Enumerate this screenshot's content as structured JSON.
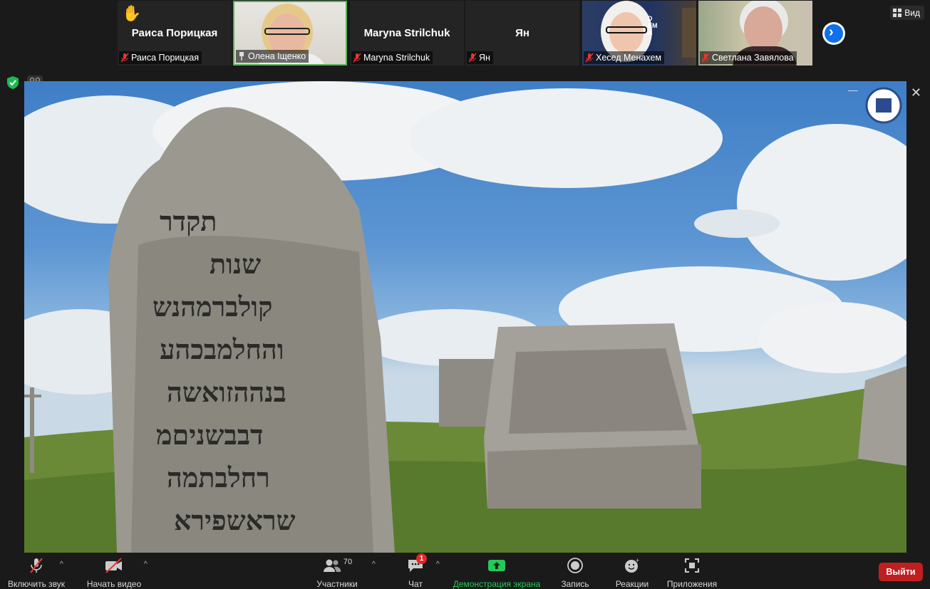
{
  "participants": [
    {
      "name_large": "Раиса Порицкая",
      "label": "Раиса Порицкая",
      "hand_raised": true,
      "video": false
    },
    {
      "name_large": "",
      "label": "Олена Іщенко",
      "hand_raised": false,
      "video": true,
      "active": true
    },
    {
      "name_large": "Maryna Strilchuk",
      "label": "Maryna Strilchuk",
      "hand_raised": false,
      "video": false
    },
    {
      "name_large": "Ян",
      "label": "Ян",
      "hand_raised": false,
      "video": false
    },
    {
      "name_large": "",
      "label": "Хесед Менахем",
      "hand_raised": false,
      "video": true
    },
    {
      "name_large": "",
      "label": "Светлана Завялова",
      "hand_raised": false,
      "video": true
    }
  ],
  "view_button": {
    "label": "Вид"
  },
  "toolbar": {
    "mute_label": "Включить звук",
    "video_label": "Начать видео",
    "participants_label": "Участники",
    "participants_count": "70",
    "chat_label": "Чат",
    "chat_badge": "1",
    "share_label": "Демонстрация экрана",
    "record_label": "Запись",
    "reactions_label": "Реакции",
    "apps_label": "Приложения",
    "leave_label": "Выйти"
  },
  "colors": {
    "share_green": "#25c85a",
    "leave_red": "#c01f1f",
    "next_blue": "#0e71eb"
  }
}
